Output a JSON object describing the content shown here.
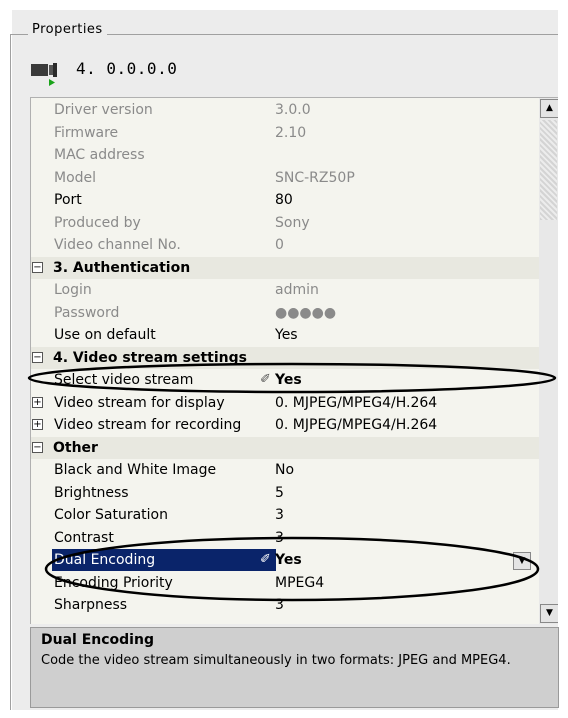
{
  "group_label": "Properties",
  "device_title": "4. 0.0.0.0",
  "rows": [
    {
      "name": "Driver version",
      "value": "3.0.0",
      "state": "disabled"
    },
    {
      "name": "Firmware",
      "value": "2.10",
      "state": "disabled"
    },
    {
      "name": "MAC address",
      "value": "",
      "state": "disabled"
    },
    {
      "name": "Model",
      "value": "SNC-RZ50P",
      "state": "disabled"
    },
    {
      "name": "Port",
      "value": "80",
      "state": "normal"
    },
    {
      "name": "Produced by",
      "value": "Sony",
      "state": "disabled"
    },
    {
      "name": "Video channel No.",
      "value": "0",
      "state": "disabled"
    },
    {
      "name": "3. Authentication",
      "value": "",
      "state": "header",
      "toggle": "⊟"
    },
    {
      "name": "Login",
      "value": "admin",
      "state": "disabled"
    },
    {
      "name": "Password",
      "value": "●●●●●",
      "state": "disabled"
    },
    {
      "name": "Use on default",
      "value": "Yes",
      "state": "normal"
    },
    {
      "name": "4. Video stream settings",
      "value": "",
      "state": "header",
      "toggle": "⊟"
    },
    {
      "name": "Select video stream",
      "value": "Yes",
      "state": "editing",
      "pen": "✐"
    },
    {
      "name": "Video stream for display",
      "value": "0. MJPEG/MPEG4/H.264",
      "state": "expandable",
      "toggle": "⊞"
    },
    {
      "name": "Video stream for recording",
      "value": "0. MJPEG/MPEG4/H.264",
      "state": "expandable",
      "toggle": "⊞"
    },
    {
      "name": "Other",
      "value": "",
      "state": "header",
      "toggle": "⊟"
    },
    {
      "name": "Black and White Image",
      "value": "No",
      "state": "normal"
    },
    {
      "name": "Brightness",
      "value": "5",
      "state": "normal"
    },
    {
      "name": "Color Saturation",
      "value": "3",
      "state": "normal"
    },
    {
      "name": "Contrast",
      "value": "3",
      "state": "normal"
    },
    {
      "name": "Dual Encoding",
      "value": "Yes",
      "state": "selected",
      "pen": "✐"
    },
    {
      "name": "Encoding Priority",
      "value": "MPEG4",
      "state": "normal"
    },
    {
      "name": "Sharpness",
      "value": "3",
      "state": "normal"
    }
  ],
  "description": {
    "title": "Dual Encoding",
    "text": "Code the video stream simultaneously in two formats: JPEG and MPEG4."
  },
  "icons": {
    "camera": "camera-icon",
    "up": "scroll-up-arrow-icon",
    "down": "scroll-down-arrow-icon",
    "dropdown": "dropdown-arrow-icon"
  },
  "colors": {
    "selection": "#0a246a",
    "panel": "#ececec",
    "grid": "#f4f4ee",
    "description": "#cfcfcf",
    "disabled_text": "#8a8a8a"
  }
}
